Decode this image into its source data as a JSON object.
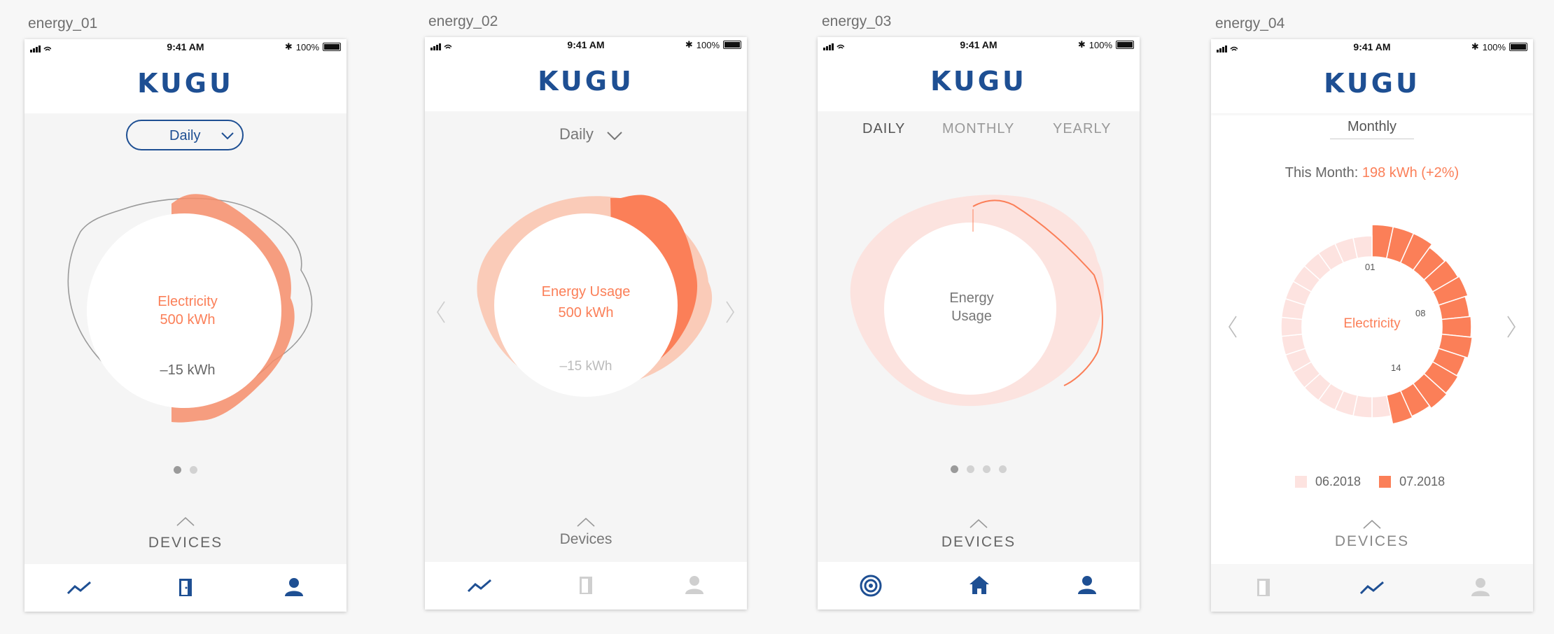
{
  "artboards": [
    {
      "label": "energy_01",
      "status": {
        "time": "9:41 AM",
        "battery": "100%"
      },
      "logo": "KUGU",
      "selector": "Daily",
      "center": {
        "title": "Electricity",
        "value": "500 kWh",
        "delta": "–15 kWh"
      },
      "pager": {
        "count": 2,
        "active": 0
      },
      "devices_label": "DEVICES",
      "nav": [
        "trend-icon",
        "door-icon",
        "user-icon"
      ]
    },
    {
      "label": "energy_02",
      "status": {
        "time": "9:41 AM",
        "battery": "100%"
      },
      "logo": "KUGU",
      "selector": "Daily",
      "center": {
        "title": "Energy Usage",
        "value": "500 kWh",
        "delta": "–15 kWh"
      },
      "devices_label": "Devices",
      "nav": [
        "trend-icon",
        "door-icon",
        "user-icon"
      ]
    },
    {
      "label": "energy_03",
      "status": {
        "time": "9:41 AM",
        "battery": "100%"
      },
      "logo": "KUGU",
      "tabs": [
        "DAILY",
        "MONTHLY",
        "YEARLY"
      ],
      "center": {
        "title_line1": "Energy",
        "title_line2": "Usage"
      },
      "pager": {
        "count": 4,
        "active": 0
      },
      "devices_label": "DEVICES",
      "nav": [
        "radar-icon",
        "home-icon",
        "user-icon"
      ]
    },
    {
      "label": "energy_04",
      "status": {
        "time": "9:41 AM",
        "battery": "100%"
      },
      "logo": "KUGU",
      "selector": "Monthly",
      "summary_label": "This Month:",
      "summary_value": "198 kWh (+2%)",
      "center": {
        "title": "Electricity"
      },
      "ring_labels": [
        "01",
        "08",
        "14"
      ],
      "legend": [
        {
          "label": "06.2018",
          "color": "#fde3e0"
        },
        {
          "label": "07.2018",
          "color": "#fb7f58"
        }
      ],
      "devices_label": "DEVICES",
      "nav": [
        "door-icon",
        "trend-icon",
        "user-icon"
      ]
    }
  ],
  "colors": {
    "brand": "#1e4f93",
    "accent": "#fb7f58",
    "accent_light": "#fde3e0"
  }
}
